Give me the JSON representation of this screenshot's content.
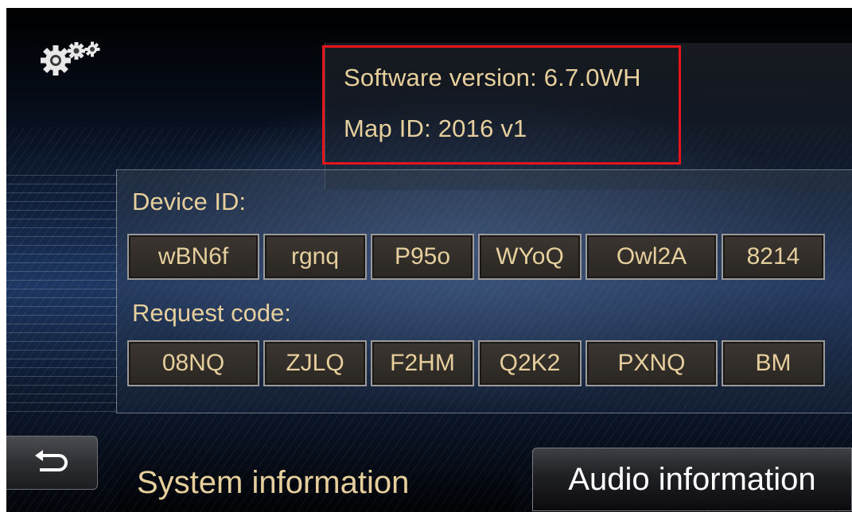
{
  "header": {
    "settings_icon": "settings-gears-icon"
  },
  "version_info": {
    "software_version": "Software version: 6.7.0WH",
    "map_id": "Map ID: 2016 v1",
    "highlight_color": "#e8141c"
  },
  "device_id": {
    "label": "Device ID:",
    "codes": [
      "wBN6f",
      "rgnq",
      "P95o",
      "WYoQ",
      "Owl2A",
      "8214"
    ]
  },
  "request_code": {
    "label": "Request code:",
    "codes": [
      "08NQ",
      "ZJLQ",
      "F2HM",
      "Q2K2",
      "PXNQ",
      "BM"
    ]
  },
  "footer": {
    "back_icon": "back-arrow-icon",
    "tabs": [
      {
        "label": "System information",
        "active": true
      },
      {
        "label": "Audio information",
        "active": false
      }
    ]
  },
  "colors": {
    "text_gold": "#e6cf9c",
    "tab_active_text": "#ffffff"
  }
}
